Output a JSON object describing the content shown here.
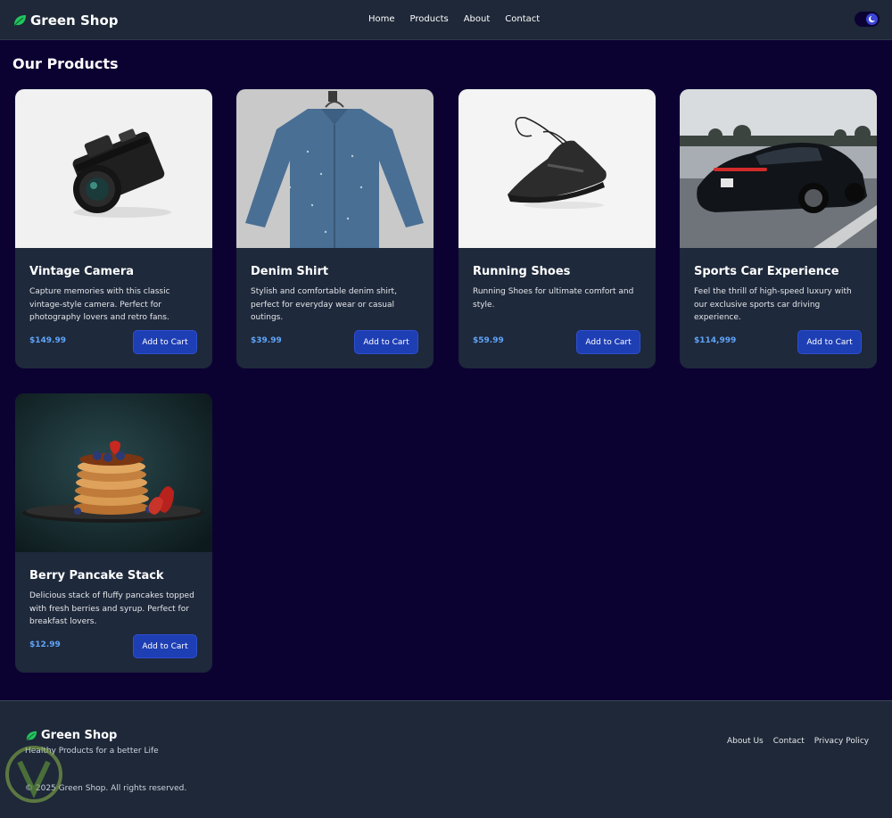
{
  "nav": {
    "brand": "Green Shop",
    "links": [
      "Home",
      "Products",
      "About",
      "Contact"
    ]
  },
  "main": {
    "title": "Our Products",
    "products": [
      {
        "title": "Vintage Camera",
        "description": "Capture memories with this classic vintage-style camera. Perfect for photography lovers and retro fans.",
        "price": "$149.99",
        "button": "Add to Cart"
      },
      {
        "title": "Denim Shirt",
        "description": "Stylish and comfortable denim shirt, perfect for everyday wear or casual outings.",
        "price": "$39.99",
        "button": "Add to Cart"
      },
      {
        "title": "Running Shoes",
        "description": "Running Shoes for ultimate comfort and style.",
        "price": "$59.99",
        "button": "Add to Cart"
      },
      {
        "title": "Sports Car Experience",
        "description": "Feel the thrill of high-speed luxury with our exclusive sports car driving experience.",
        "price": "$114,999",
        "button": "Add to Cart"
      },
      {
        "title": "Berry Pancake Stack",
        "description": "Delicious stack of fluffy pancakes topped with fresh berries and syrup. Perfect for breakfast lovers.",
        "price": "$12.99",
        "button": "Add to Cart"
      }
    ]
  },
  "footer": {
    "brand": "Green Shop",
    "tagline": "Healthy Products for a better Life",
    "links": [
      "About Us",
      "Contact",
      "Privacy Policy"
    ],
    "copyright": "© 2025 Green Shop. All rights reserved."
  },
  "icons": {
    "brand": "leaf-icon",
    "theme_toggle": "moon-icon"
  },
  "colors": {
    "page_bg": "#0c0232",
    "nav_bg": "#1e2838",
    "card_bg": "#1e293b",
    "button_bg": "#1e3eb4",
    "price": "#60a5fa",
    "leaf": "#22c55e"
  }
}
